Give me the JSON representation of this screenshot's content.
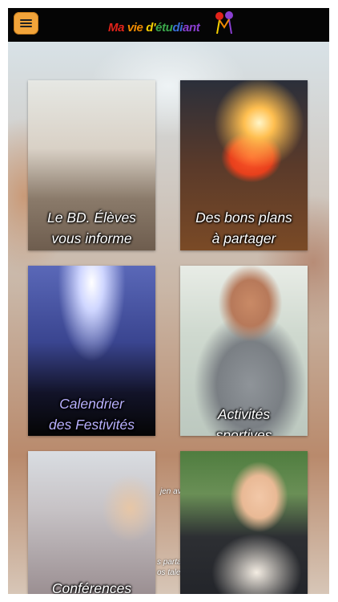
{
  "header": {
    "menu_icon": "hamburger-menu-icon",
    "logo_parts": [
      "Ma",
      " vie",
      " d'",
      "étu",
      "di",
      "ant"
    ],
    "logo_colors": [
      "#e2231a",
      "#f08a00",
      "#f6d000",
      "#3aa64a",
      "#3a6ed8",
      "#8a3fd1"
    ],
    "accent": "#f2a43a"
  },
  "tiles": [
    {
      "line1": "Le BD. Élèves",
      "line2": "vous informe"
    },
    {
      "line1": "Des bons plans",
      "line2": "à partager"
    },
    {
      "line1": "Calendrier",
      "line2": "des Festivités"
    },
    {
      "line1": "Activités",
      "line2": "sportives"
    },
    {
      "line1": "Conférences",
      "line2": ""
    },
    {
      "line1": "",
      "line2": ""
    }
  ],
  "background_fragments": {
    "mid_a": "jen av",
    "mid_b": "s parta",
    "mid_c": "os talen"
  }
}
